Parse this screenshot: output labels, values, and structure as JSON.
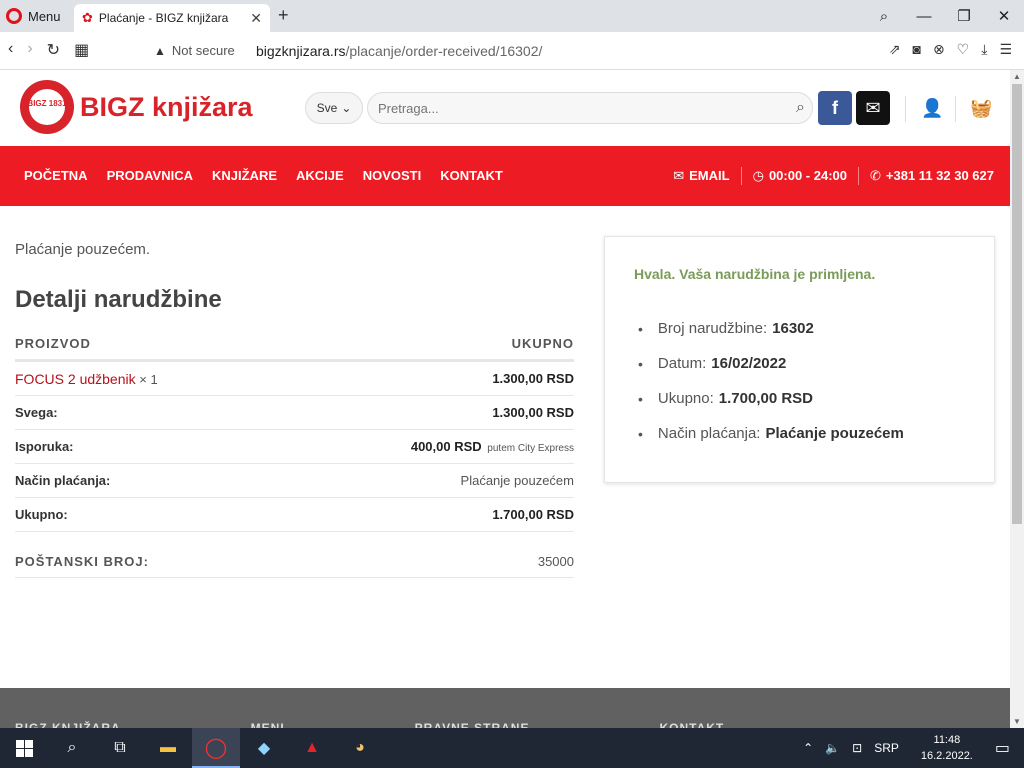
{
  "browser": {
    "menu_label": "Menu",
    "tab_title": "Plaćanje - BIGZ knjižara",
    "security_label": "Not secure",
    "url_domain": "bigzknjizara.rs",
    "url_path": "/placanje/order-received/16302/"
  },
  "header": {
    "logo_badge": "BIGZ 1831",
    "logo_text": "BIGZ knjižara",
    "search_category": "Sve",
    "search_placeholder": "Pretraga..."
  },
  "nav": {
    "items": [
      "POČETNA",
      "PRODAVNICA",
      "KNJIŽARE",
      "AKCIJE",
      "NOVOSTI",
      "KONTAKT"
    ],
    "email_label": "EMAIL",
    "hours_label": "00:00 - 24:00",
    "phone_label": "+381 11 32 30 627"
  },
  "order": {
    "payment_note": "Plaćanje pouzećem.",
    "details_title": "Detalji narudžbine",
    "col_product": "PROIZVOD",
    "col_total": "UKUPNO",
    "product_name": "FOCUS 2 udžbenik",
    "product_qty": "× 1",
    "product_total": "1.300,00 RSD",
    "subtotal_label": "Svega:",
    "subtotal_value": "1.300,00 RSD",
    "shipping_label": "Isporuka:",
    "shipping_value": "400,00 RSD",
    "shipping_via": "putem City Express",
    "method_label": "Način plaćanja:",
    "method_value": "Plaćanje pouzećem",
    "total_label": "Ukupno:",
    "total_value": "1.700,00 RSD",
    "postal_label": "POŠTANSKI BROJ:",
    "postal_value": "35000"
  },
  "summary": {
    "thanks": "Hvala. Vaša narudžbina je primljena.",
    "number_label": "Broj narudžbine:",
    "number_value": "16302",
    "date_label": "Datum:",
    "date_value": "16/02/2022",
    "total_label": "Ukupno:",
    "total_value": "1.700,00 RSD",
    "method_label": "Način plaćanja:",
    "method_value": "Plaćanje pouzećem"
  },
  "footer": {
    "headings": [
      "BIGZ KNJIŽARA",
      "MENI",
      "PRAVNE STRANE",
      "KONTAKT"
    ]
  },
  "taskbar": {
    "language": "SRP",
    "time": "11:48",
    "date": "16.2.2022."
  },
  "colors": {
    "brand_red": "#ed1c24",
    "thanks_green": "#7a9c59",
    "facebook_blue": "#3b5998"
  }
}
